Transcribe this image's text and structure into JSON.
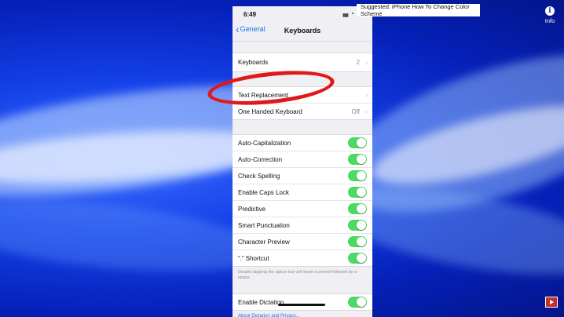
{
  "status": {
    "time": "6:49"
  },
  "nav": {
    "back_label": "General",
    "title": "Keyboards"
  },
  "keyboards_row": {
    "label": "Keyboards",
    "count": "2"
  },
  "text_replacement": {
    "label": "Text Replacement"
  },
  "one_handed": {
    "label": "One Handed Keyboard",
    "value": "Off"
  },
  "toggles": [
    {
      "label": "Auto-Capitalization",
      "on": true
    },
    {
      "label": "Auto-Correction",
      "on": true
    },
    {
      "label": "Check Spelling",
      "on": true
    },
    {
      "label": "Enable Caps Lock",
      "on": true
    },
    {
      "label": "Predictive",
      "on": true
    },
    {
      "label": "Smart Punctuation",
      "on": true
    },
    {
      "label": "Character Preview",
      "on": true
    },
    {
      "label": "“.” Shortcut",
      "on": true
    }
  ],
  "shortcut_footnote": "Double tapping the space bar will insert a period followed by a space.",
  "dictation": {
    "label": "Enable Dictation",
    "on": true,
    "link": "About Dictation and Privacy..."
  },
  "overlay": {
    "suggested": "Suggested: iPhone How To Change Color Scheme",
    "info_label": "Info"
  },
  "colors": {
    "toggle_on": "#4cd964",
    "accent": "#1a73e8",
    "annotation": "#e01818"
  }
}
